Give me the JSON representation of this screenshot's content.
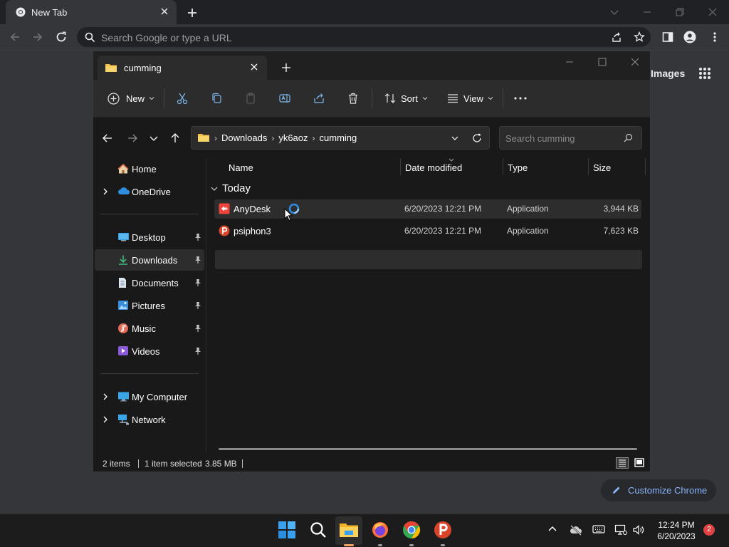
{
  "chrome": {
    "tab_title": "New Tab",
    "omnibox_placeholder": "Search Google or type a URL",
    "images_link": "Images",
    "customize_label": "Customize Chrome"
  },
  "explorer": {
    "tab_title": "cumming",
    "toolbar": {
      "new_label": "New",
      "sort_label": "Sort",
      "view_label": "View"
    },
    "breadcrumb": [
      "Downloads",
      "yk6aoz",
      "cumming"
    ],
    "search_placeholder": "Search cumming",
    "sidebar": {
      "home": "Home",
      "onedrive": "OneDrive",
      "desktop": "Desktop",
      "downloads": "Downloads",
      "documents": "Documents",
      "pictures": "Pictures",
      "music": "Music",
      "videos": "Videos",
      "my_computer": "My Computer",
      "network": "Network"
    },
    "columns": {
      "name": "Name",
      "date": "Date modified",
      "type": "Type",
      "size": "Size"
    },
    "group": "Today",
    "files": [
      {
        "name": "AnyDesk",
        "date": "6/20/2023 12:21 PM",
        "type": "Application",
        "size": "3,944 KB"
      },
      {
        "name": "psiphon3",
        "date": "6/20/2023 12:21 PM",
        "type": "Application",
        "size": "7,623 KB"
      }
    ],
    "status": {
      "count": "2 items",
      "selected": "1 item selected",
      "size": "3.85 MB"
    }
  },
  "taskbar": {
    "time": "12:24 PM",
    "date": "6/20/2023",
    "notifications": "2"
  },
  "colors": {
    "accent": "#8ab4f8",
    "folder": "#f0c04a",
    "anydesk": "#ef443b",
    "psiphon": "#d9442b"
  }
}
